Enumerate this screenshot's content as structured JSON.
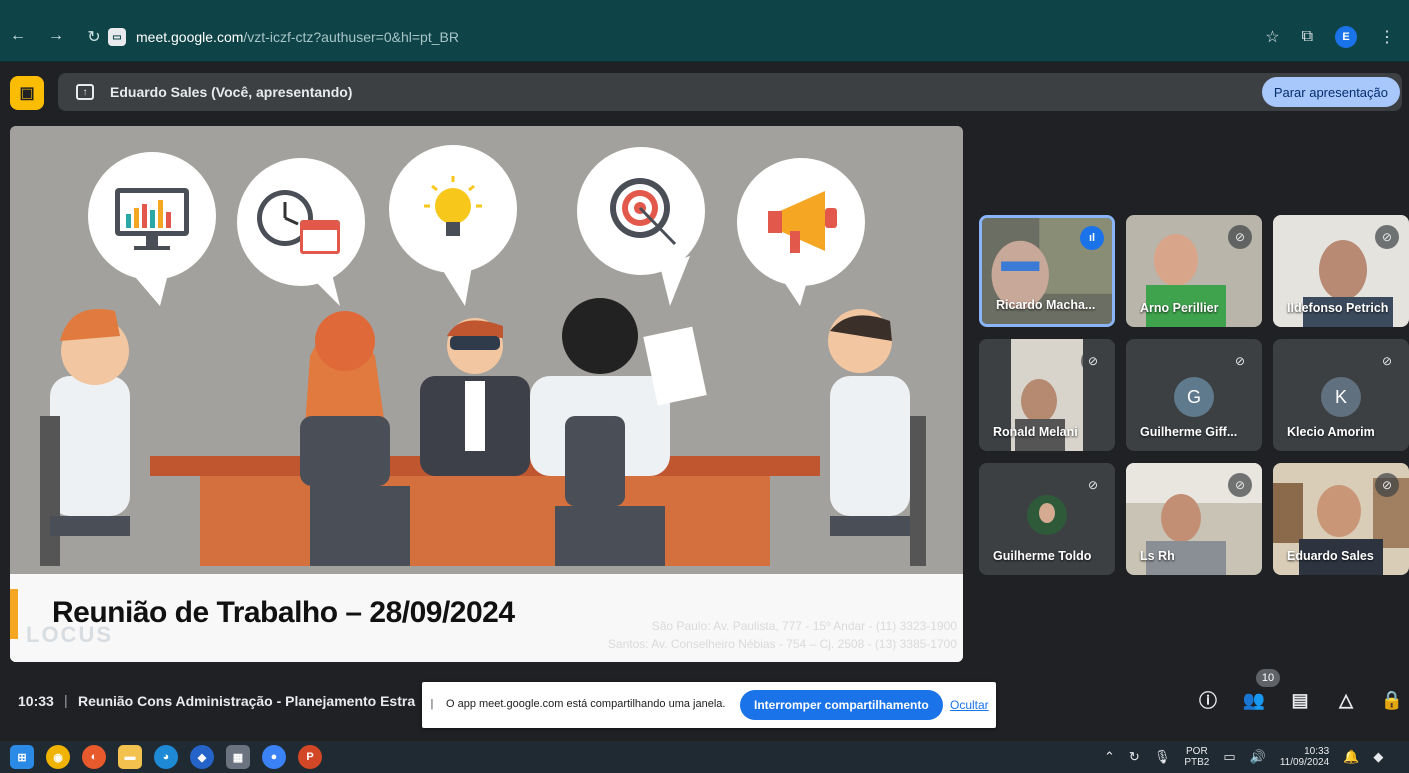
{
  "browser": {
    "url_host": "meet.google.com",
    "url_path": "/vzt-iczf-ctz?authuser=0&hl=pt_BR",
    "profile_initial": "E"
  },
  "presenting": {
    "label": "Eduardo Sales (Você, apresentando)",
    "stop_button": "Parar apresentação"
  },
  "slide": {
    "title": "Reunião de Trabalho – 28/09/2024",
    "logo": "LOCUS",
    "address_line1": "São Paulo: Av. Paulista, 777 - 15º Andar - (11) 3323-1900",
    "address_line2": "Santos: Av. Conselheiro Nébias - 754 – Cj. 2508 - (13) 3385-1700"
  },
  "participants": [
    {
      "name": "Ricardo Macha...",
      "speaking": true
    },
    {
      "name": "Arno Perillier",
      "muted": true
    },
    {
      "name": "Ildefonso Petrich",
      "muted": true
    },
    {
      "name": "Ronald Melani",
      "muted": true
    },
    {
      "name": "Guilherme Giff...",
      "muted": true,
      "initial": "G"
    },
    {
      "name": "Klecio Amorim",
      "muted": true,
      "initial": "K"
    },
    {
      "name": "Guilherme Toldo",
      "muted": true
    },
    {
      "name": "Ls Rh",
      "muted": true
    },
    {
      "name": "Eduardo Sales",
      "muted": true
    }
  ],
  "meeting": {
    "time": "10:33",
    "separator": "|",
    "title": "Reunião Cons Administração - Planejamento Estra",
    "people_count": "10"
  },
  "share_notice": {
    "text": "O app meet.google.com está compartilhando uma janela.",
    "stop_button": "Interromper compartilhamento",
    "hide_link": "Ocultar"
  },
  "taskbar": {
    "lang_line1": "POR",
    "lang_line2": "PTB2",
    "clock_time": "10:33",
    "clock_date": "11/09/2024"
  },
  "colors": {
    "accent_blue": "#1a73e8",
    "browser_teal": "#0e4448",
    "present_yellow": "#fbbc04",
    "stop_button_bg": "#a8c7fa"
  }
}
